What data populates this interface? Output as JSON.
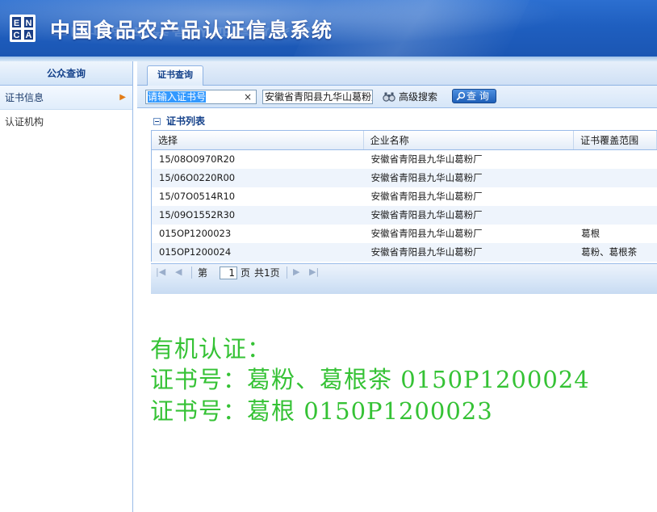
{
  "header": {
    "logo_text": "ENCA",
    "title": "中国食品农产品认证信息系统"
  },
  "sidebar": {
    "heading": "公众查询",
    "items": [
      {
        "label": "证书信息",
        "active": true,
        "marker": "▶"
      },
      {
        "label": "认证机构",
        "active": false
      }
    ]
  },
  "tabs": [
    {
      "label": "证书查询",
      "active": true
    }
  ],
  "toolbar": {
    "cert_input": {
      "value": "请输入证书号",
      "placeholder": "请输入证书号"
    },
    "clear_glyph": "×",
    "company_input": {
      "value": "安徽省青阳县九华山葛粉厂"
    },
    "advanced_label": "高级搜索",
    "query_label": "查 询"
  },
  "list": {
    "title": "证书列表",
    "columns": [
      "选择",
      "企业名称",
      "证书覆盖范围"
    ],
    "rows": [
      [
        "15/08O0970R20",
        "安徽省青阳县九华山葛粉厂",
        ""
      ],
      [
        "15/06O0220R00",
        "安徽省青阳县九华山葛粉厂",
        ""
      ],
      [
        "15/07O0514R10",
        "安徽省青阳县九华山葛粉厂",
        ""
      ],
      [
        "15/09O1552R30",
        "安徽省青阳县九华山葛粉厂",
        ""
      ],
      [
        "015OP1200023",
        "安徽省青阳县九华山葛粉厂",
        "葛根"
      ],
      [
        "015OP1200024",
        "安徽省青阳县九华山葛粉厂",
        "葛粉、葛根茶"
      ]
    ]
  },
  "pager": {
    "page_prefix": "第",
    "page_value": "1",
    "page_suffix": "页",
    "total_text": "共1页",
    "first_glyph": "|◀",
    "prev_glyph": "◀",
    "next_glyph": "▶",
    "last_glyph": "▶|"
  },
  "annotation": {
    "lines": [
      "有机认证：",
      "证书号：葛粉、葛根茶  0150P1200024",
      "证书号：葛根  0150P1200023"
    ]
  },
  "colors": {
    "header_blue": "#1f5fc0",
    "accent_text": "#15428b",
    "annotation_green": "#35c235",
    "sidebar_arrow": "#e27b16"
  }
}
